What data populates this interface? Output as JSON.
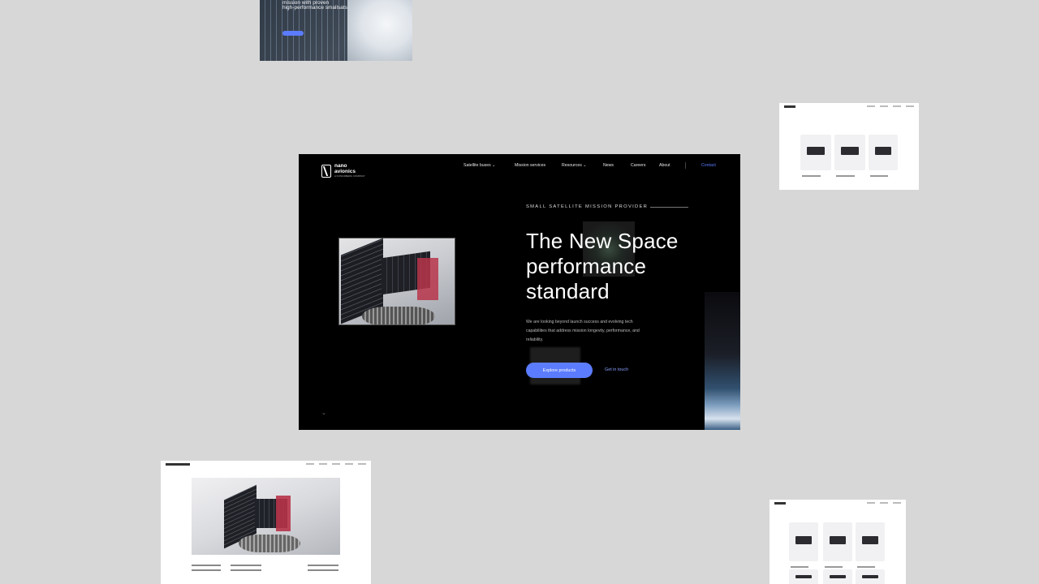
{
  "thumb_top": {
    "line1": "mission with proven",
    "line2": "high-performance smallsats"
  },
  "hero": {
    "logo_line1": "nano",
    "logo_line2": "avionics",
    "logo_sub": "A KONGSBERG COMPANY",
    "nav": [
      "Satellite buses ⌄",
      "Mission services",
      "Resources ⌄",
      "News",
      "Careers",
      "About"
    ],
    "contact": "Contact",
    "eyebrow": "SMALL SATELLITE MISSION PROVIDER",
    "title": "The New Space performance standard",
    "body": "We are looking beyond launch success and evolving tech capabilities that address mission longevity, performance, and reliability.",
    "cta_primary": "Explore products",
    "cta_secondary": "Get in touch",
    "scroll_icon": "chevron-down-icon"
  },
  "thumb_bottom_left": {
    "nav_brand": "KONGSBERG"
  },
  "colors": {
    "background": "#d7d7d7",
    "accent": "#5b7cff",
    "hero_bg": "#000000"
  }
}
